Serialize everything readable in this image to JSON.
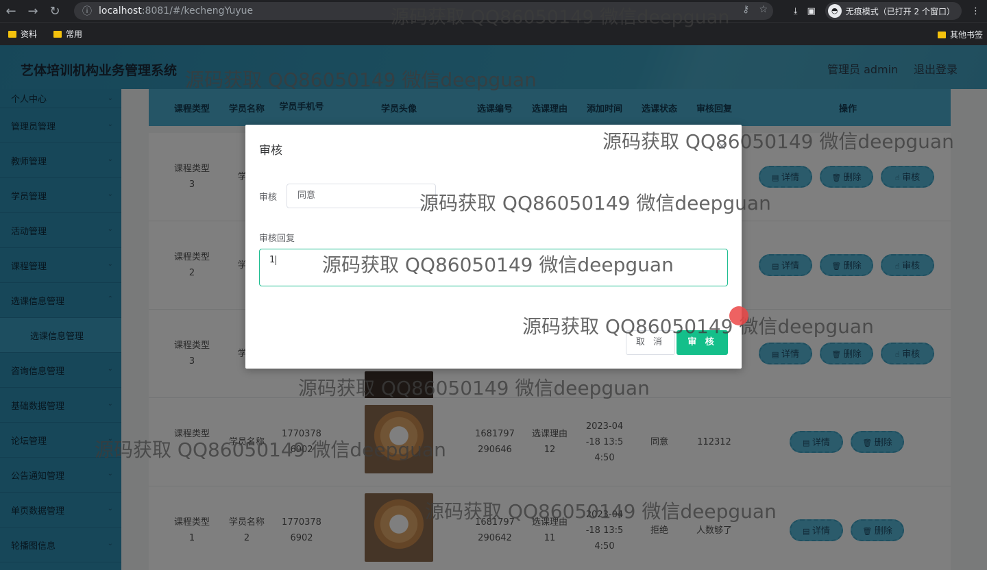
{
  "browser": {
    "url_host": "localhost",
    "url_rest": ":8081/#/kechengYuyue",
    "incognito_label": "无痕模式（已打开 2 个窗口）",
    "bookmarks": [
      "资料",
      "常用"
    ],
    "bookmarks_right": "其他书签"
  },
  "header": {
    "title": "艺体培训机构业务管理系统",
    "user": "管理员 admin",
    "logout": "退出登录"
  },
  "sidebar": {
    "items": [
      "个人中心",
      "管理员管理",
      "教师管理",
      "学员管理",
      "活动管理",
      "课程管理",
      "选课信息管理",
      "选课信息管理",
      "咨询信息管理",
      "基础数据管理",
      "论坛管理",
      "公告通知管理",
      "单页数据管理",
      "轮播图信息"
    ]
  },
  "table": {
    "headers": [
      "课程类型",
      "学员名称",
      "学员手机号",
      "学员头像",
      "选课编号",
      "选课理由",
      "添加时间",
      "选课状态",
      "审核回复",
      "操作"
    ],
    "rows": [
      {
        "type": "课程类型\n3",
        "name": "学员",
        "phone": "",
        "code": "",
        "reason": "",
        "time": "",
        "status": "",
        "reply": "",
        "ops": [
          "详情",
          "删除",
          "审核"
        ]
      },
      {
        "type": "课程类型\n2",
        "name": "学员",
        "phone": "",
        "code": "",
        "reason": "",
        "time": "",
        "status": "",
        "reply": "",
        "ops": [
          "详情",
          "删除",
          "审核"
        ]
      },
      {
        "type": "课程类型\n3",
        "name": "学员",
        "phone": "",
        "code": "",
        "reason": "",
        "time": "",
        "status": "",
        "reply": "",
        "ops": [
          "详情",
          "删除",
          "审核"
        ]
      },
      {
        "type": "课程类型\n",
        "name": "学员名称",
        "phone": "1770378\n6902",
        "code": "1681797\n290646",
        "reason": "选课理由\n12",
        "time": "2023-04\n-18 13:5\n4:50",
        "status": "同意",
        "reply": "112312",
        "ops": [
          "详情",
          "删除"
        ]
      },
      {
        "type": "课程类型\n1",
        "name": "学员名称\n2",
        "phone": "1770378\n6902",
        "code": "1681797\n290642",
        "reason": "选课理由\n11",
        "time": "2023-04\n-18 13:5\n4:50",
        "status": "拒绝",
        "reply": "人数够了",
        "ops": [
          "详情",
          "删除"
        ]
      }
    ]
  },
  "dialog": {
    "title": "审核",
    "label_audit": "审核",
    "select_value": "同意",
    "label_reply": "审核回复",
    "reply_value": "1",
    "cancel": "取 消",
    "ok": "审 核"
  },
  "watermark": "源码获取 QQ86050149 微信deepguan"
}
